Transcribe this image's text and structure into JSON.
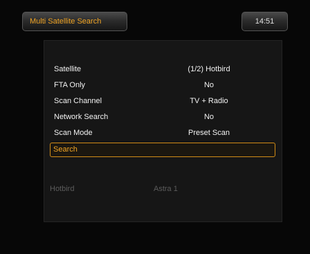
{
  "header": {
    "title": "Multi Satellite Search",
    "clock": "14:51"
  },
  "menu": {
    "items": [
      {
        "label": "Satellite",
        "value": "(1/2) Hotbird"
      },
      {
        "label": "FTA Only",
        "value": "No"
      },
      {
        "label": "Scan Channel",
        "value": "TV + Radio"
      },
      {
        "label": "Network Search",
        "value": "No"
      },
      {
        "label": "Scan Mode",
        "value": "Preset Scan"
      }
    ],
    "search_label": "Search"
  },
  "satellites": [
    "Hotbird",
    "Astra 1"
  ],
  "colors": {
    "accent": "#f0a424",
    "highlight_border": "#d28c16",
    "background": "#070707",
    "panel": "#161616"
  }
}
